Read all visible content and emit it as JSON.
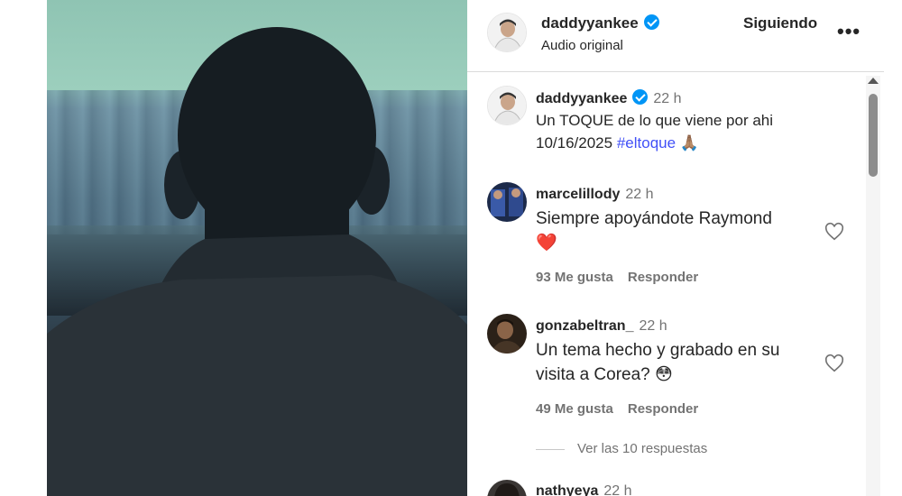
{
  "post": {
    "username": "daddyyankee",
    "audio_label": "Audio original",
    "follow_label": "Siguiendo",
    "more_label": "•••"
  },
  "caption": {
    "username": "daddyyankee",
    "time": "22 h",
    "text_line1": "Un TOQUE de lo que viene por ahi",
    "date": "10/16/2025",
    "hashtag": "#eltoque",
    "emoji": "🙏🏽"
  },
  "comments": [
    {
      "username": "marcelillody",
      "time": "22 h",
      "text": "Siempre apoyándote Raymond",
      "emoji": "❤️",
      "likes": "93 Me gusta",
      "reply_label": "Responder"
    },
    {
      "username": "gonzabeltran_",
      "time": "22 h",
      "text": "Un tema hecho y grabado en su visita a Corea?",
      "emoji": "😳",
      "likes": "49 Me gusta",
      "reply_label": "Responder",
      "view_replies": "Ver las 10 respuestas"
    },
    {
      "username": "nathyeya",
      "time": "22 h"
    }
  ],
  "colors": {
    "verified": "#0095f6",
    "hashtag": "#4150f7",
    "heart_pink": "#f24f7c"
  }
}
